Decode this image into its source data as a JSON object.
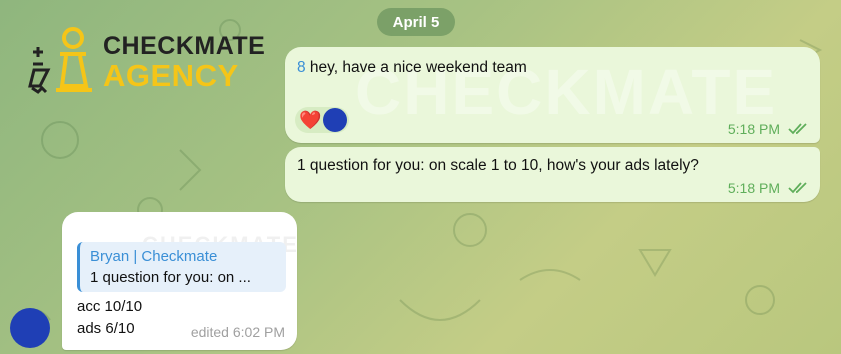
{
  "date_separator": "April 5",
  "logo": {
    "line1": "CHECKMATE",
    "line2": "AGENCY"
  },
  "messages_outgoing": [
    {
      "mention": "8",
      "text": " hey, have a nice weekend team",
      "time": "5:18 PM",
      "reactions": [
        {
          "emoji": "❤️"
        }
      ]
    },
    {
      "text": "1 question for you: on scale 1 to 10, how's your ads lately?",
      "time": "5:18 PM"
    }
  ],
  "message_incoming": {
    "reply_sender": "Bryan | Checkmate",
    "reply_preview": "1 question for you: on ...",
    "line1": "acc 10/10",
    "line2": "ads 6/10",
    "edited_time": "edited 6:02 PM"
  },
  "watermark_text": "CHECKMATE",
  "colors": {
    "outgoing_bubble": "#eaf7da",
    "link": "#3a8fd6",
    "check": "#5fae5a",
    "avatar": "#1f3fb5"
  }
}
